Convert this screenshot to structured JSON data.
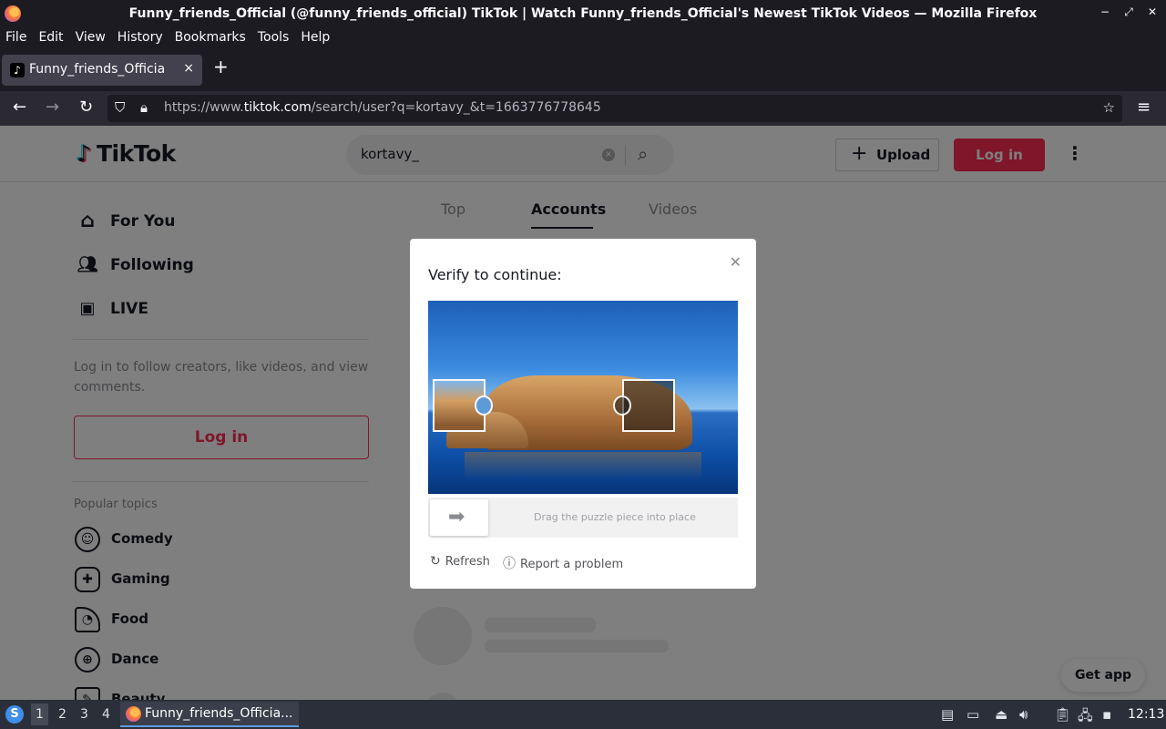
{
  "window": {
    "title": "Funny_friends_Official (@funny_friends_official) TikTok | Watch Funny_friends_Official's Newest TikTok Videos — Mozilla Firefox",
    "controls": [
      "−",
      "⤢",
      "✕"
    ]
  },
  "menubar": {
    "items": [
      "File",
      "Edit",
      "View",
      "History",
      "Bookmarks",
      "Tools",
      "Help"
    ]
  },
  "browser_tab": {
    "title": "Funny_friends_Official (@",
    "close": "×",
    "new_tab": "+"
  },
  "addressbar": {
    "url_prefix": "https://www.",
    "url_domain": "tiktok.com",
    "url_path": "/search/user?q=kortavy_&t=1663776778645"
  },
  "header": {
    "logo_text": "TikTok",
    "search_value": "kortavy_",
    "upload_label": "Upload",
    "login_label": "Log in"
  },
  "sidebar": {
    "nav": [
      {
        "label": "For You",
        "icon": "home-icon"
      },
      {
        "label": "Following",
        "icon": "users-icon"
      },
      {
        "label": "LIVE",
        "icon": "live-icon"
      }
    ],
    "login_prompt": "Log in to follow creators, like videos, and view comments.",
    "login_button": "Log in",
    "popular_title": "Popular topics",
    "topics": [
      "Comedy",
      "Gaming",
      "Food",
      "Dance",
      "Beauty"
    ]
  },
  "search_tabs": [
    "Top",
    "Accounts",
    "Videos"
  ],
  "active_search_tab": "Accounts",
  "get_app": "Get app",
  "captcha": {
    "title": "Verify to continue:",
    "slider_hint": "Drag the puzzle piece into place",
    "refresh": "Refresh",
    "report": "Report a problem"
  },
  "taskbar": {
    "workspaces": [
      "1",
      "2",
      "3",
      "4"
    ],
    "active_workspace": "1",
    "task_label": "Funny_friends_Officia...",
    "clock": "12:13"
  },
  "colors": {
    "brand": "#fe2c55",
    "browser_dark": "#1c1b22",
    "taskbar": "#2b2f3a"
  }
}
